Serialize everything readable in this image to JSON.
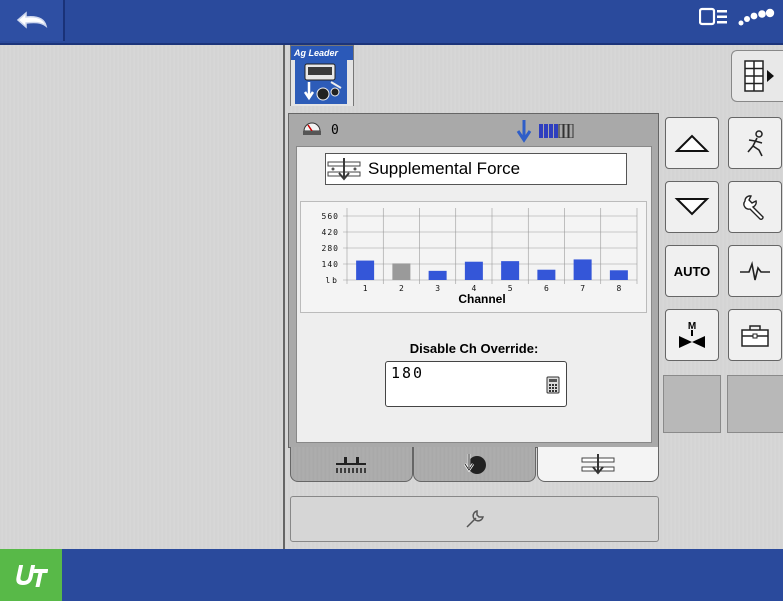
{
  "header": {
    "status": {
      "rate_value": "0"
    }
  },
  "app": {
    "tab_label": "Ag Leader"
  },
  "panel": {
    "channel_mode": "Supplemental Force",
    "override": {
      "label": "Disable Ch Override:",
      "value": "180"
    }
  },
  "side_buttons": {
    "auto_label": "AUTO"
  },
  "colors": {
    "bar_active": "#3456d8",
    "bar_inactive": "#9a9a9a",
    "header_blue": "#2a4a9c",
    "logo_green": "#58b948"
  },
  "chart_data": {
    "type": "bar",
    "categories": [
      "1",
      "2",
      "3",
      "4",
      "5",
      "6",
      "7",
      "8"
    ],
    "values": [
      170,
      145,
      80,
      160,
      165,
      90,
      180,
      85
    ],
    "bar_colors": [
      "active",
      "inactive",
      "active",
      "active",
      "active",
      "active",
      "active",
      "active"
    ],
    "xlabel": "Channel",
    "ylabel": "lb",
    "yticks": [
      140,
      280,
      420,
      560
    ],
    "ylim": [
      0,
      630
    ]
  }
}
